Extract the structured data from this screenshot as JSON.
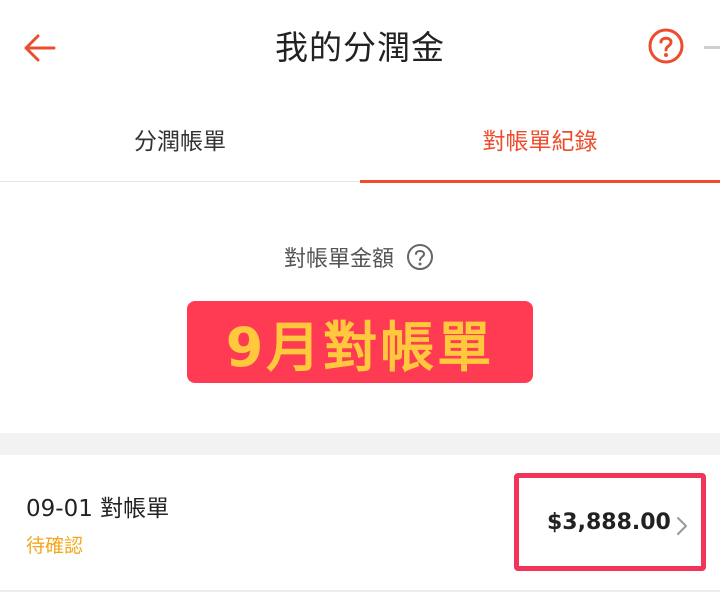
{
  "header": {
    "title": "我的分潤金",
    "back_icon": "arrow-left-icon",
    "help_icon": "question-circle-icon"
  },
  "tabs": [
    {
      "label": "分潤帳單",
      "active": false
    },
    {
      "label": "對帳單紀錄",
      "active": true
    }
  ],
  "summary": {
    "label": "對帳單金額",
    "help_icon": "question-circle-icon",
    "banner_text": "9月對帳單"
  },
  "records": [
    {
      "title": "09-01 對帳單",
      "status": "待確認",
      "amount": "$3,888.00",
      "chevron_icon": "chevron-right-icon"
    }
  ],
  "colors": {
    "accent": "#ee4d2d",
    "status_pending": "#f2a81d",
    "banner_bg": "#ff3b54",
    "banner_text": "#ffc83d",
    "highlight_box": "#f2345a"
  }
}
